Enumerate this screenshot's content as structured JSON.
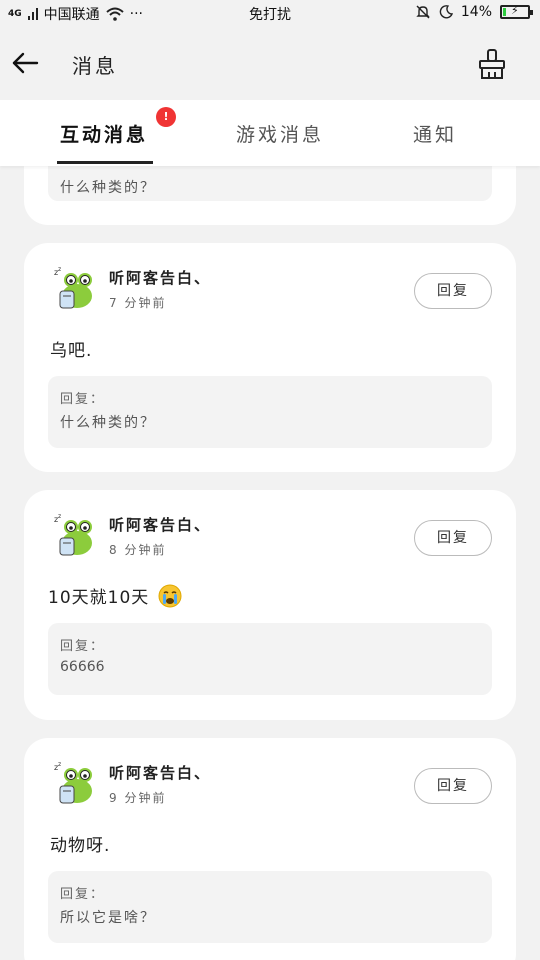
{
  "status_bar": {
    "network": "4G",
    "carrier": "中国联通",
    "more": "···",
    "mode": "免打扰",
    "battery": "14%",
    "battery_level": 0.14,
    "icons": [
      "signal-icon",
      "wifi-icon",
      "mute-bell-icon",
      "moon-icon",
      "battery-icon"
    ]
  },
  "header": {
    "title": "消息",
    "back_icon": "arrow-left-icon",
    "clean_icon": "broom-icon"
  },
  "tabs": {
    "items": [
      {
        "label": "互动消息",
        "active": true,
        "badge": "!"
      },
      {
        "label": "游戏消息",
        "active": false
      },
      {
        "label": "通知",
        "active": false
      }
    ]
  },
  "partial_card": {
    "quote_text": "什么种类的？"
  },
  "messages": [
    {
      "user": "听阿客告白、",
      "time": "7 分钟前",
      "reply_button": "回复",
      "content": "乌吧.",
      "quote_label": "回复：",
      "quote_text": "什么种类的？"
    },
    {
      "user": "听阿客告白、",
      "time": "8 分钟前",
      "reply_button": "回复",
      "content": "10天就10天",
      "emoji": "crying-emoji",
      "quote_label": "回复：",
      "quote_text": "66666"
    },
    {
      "user": "听阿客告白、",
      "time": "9 分钟前",
      "reply_button": "回复",
      "content": "动物呀.",
      "quote_label": "回复：",
      "quote_text": "所以它是啥？"
    }
  ],
  "colors": {
    "background": "#f2f2f2",
    "card": "#ffffff",
    "badge": "#f03434",
    "quote_bg": "#f3f3f3",
    "avatar_green": "#8ccc3c"
  }
}
